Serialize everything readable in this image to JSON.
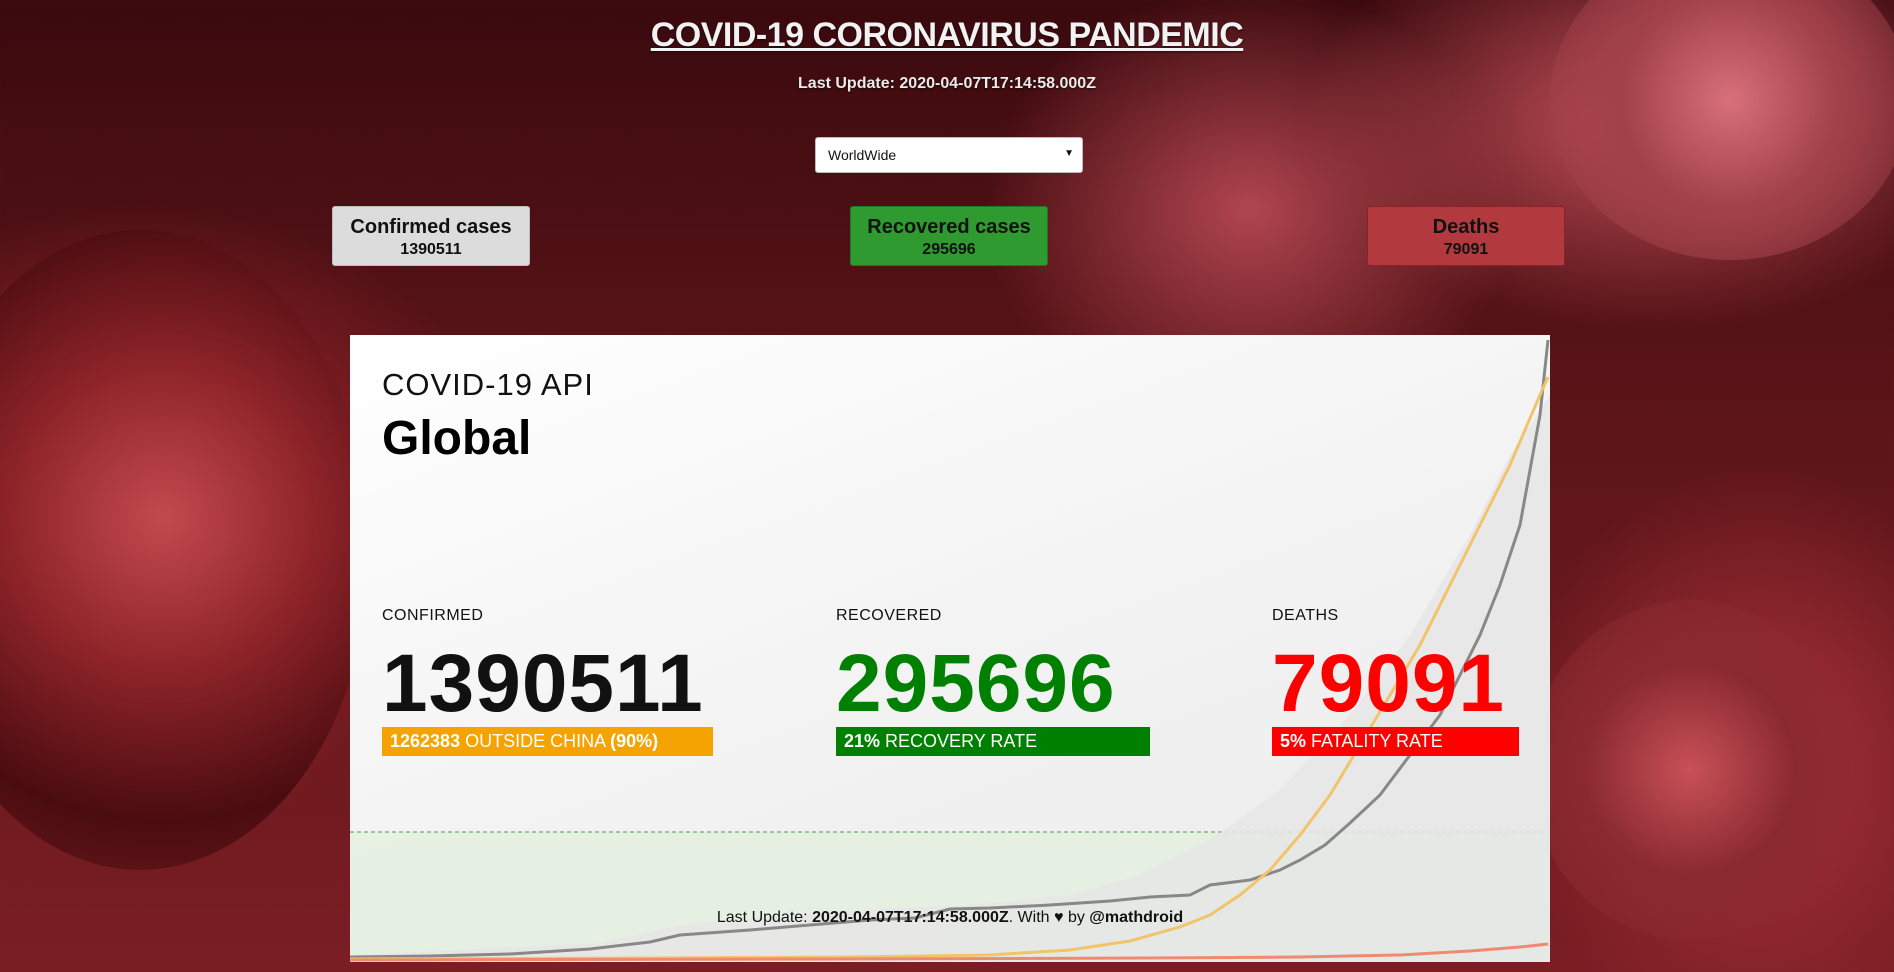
{
  "header": {
    "title": "COVID-19 CORONAVIRUS PANDEMIC",
    "last_update_label": "Last Update:",
    "last_update_value": "2020-04-07T17:14:58.000Z"
  },
  "country_select": {
    "selected": "WorldWide"
  },
  "cards": {
    "confirmed": {
      "label": "Confirmed cases",
      "value": "1390511"
    },
    "recovered": {
      "label": "Recovered cases",
      "value": "295696"
    },
    "deaths": {
      "label": "Deaths",
      "value": "79091"
    }
  },
  "panel": {
    "api_title": "COVID-19 API",
    "region_title": "Global",
    "confirmed": {
      "label": "CONFIRMED",
      "value": "1390511",
      "badge_strong": "1262383",
      "badge_text": "OUTSIDE CHINA",
      "badge_pct": "(90%)"
    },
    "recovered": {
      "label": "RECOVERED",
      "value": "295696",
      "badge_strong": "21%",
      "badge_text": "RECOVERY RATE"
    },
    "deaths": {
      "label": "DEATHS",
      "value": "79091",
      "badge_strong": "5%",
      "badge_text": "FATALITY RATE"
    },
    "footer": {
      "prefix": "Last Update:",
      "timestamp": "2020-04-07T17:14:58.000Z",
      "with_text": ". With",
      "heart": "♥",
      "by_text": "by",
      "author": "@mathdroid"
    }
  },
  "colors": {
    "confirmed_badge": "#f5a300",
    "recovered": "#008000",
    "deaths": "#ff0000",
    "line_confirmed": "#888888",
    "line_other": "#f2c46a",
    "line_deaths": "#ef8a70"
  },
  "icons": {
    "select_arrow": "chevron-down-icon",
    "heart": "heart-icon"
  }
}
